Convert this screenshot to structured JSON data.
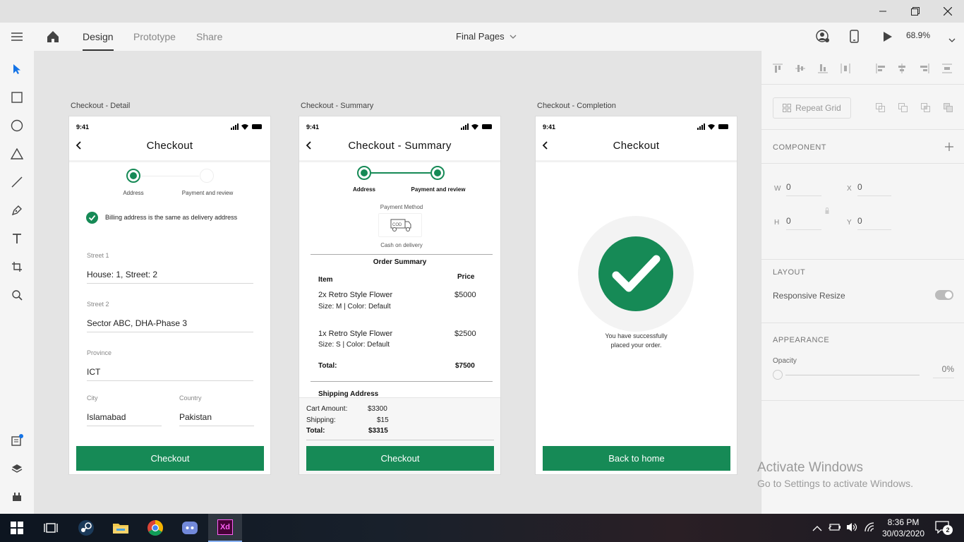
{
  "titlebar": {
    "minimize_icon": "minimize-icon",
    "maximize_icon": "restore-icon",
    "close_icon": "close-icon"
  },
  "menubar": {
    "tabs": [
      "Design",
      "Prototype",
      "Share"
    ],
    "document_title": "Final Pages",
    "zoom": "68.9%"
  },
  "artboards": {
    "detail": {
      "label": "Checkout - Detail",
      "time": "9:41",
      "title": "Checkout",
      "steps": [
        "Address",
        "Payment and review"
      ],
      "billing_same": "Billing address is the same as delivery address",
      "fields": {
        "street1_label": "Street 1",
        "street1_value": "House: 1, Street: 2",
        "street2_label": "Street 2",
        "street2_value": "Sector ABC, DHA-Phase 3",
        "province_label": "Province",
        "province_value": "ICT",
        "city_label": "City",
        "city_value": "Islamabad",
        "country_label": "Country",
        "country_value": "Pakistan"
      },
      "button": "Checkout"
    },
    "summary": {
      "label": "Checkout - Summary",
      "time": "9:41",
      "title": "Checkout - Summary",
      "steps": [
        "Address",
        "Payment and review"
      ],
      "payment_method_label": "Payment Method",
      "cod_text": "COD",
      "cash_on_delivery": "Cash on delivery",
      "order_summary": "Order Summary",
      "col_item": "Item",
      "col_price": "Price",
      "items": [
        {
          "name": "2x Retro Style Flower",
          "detail": "Size: M | Color: Default",
          "price": "$5000"
        },
        {
          "name": "1x Retro Style Flower",
          "detail": "Size: S | Color: Default",
          "price": "$2500"
        }
      ],
      "total_label": "Total:",
      "total_value": "$7500",
      "shipping_address": "Shipping Address",
      "cart_amount_label": "Cart Amount:",
      "cart_amount_value": "$3300",
      "shipping_label": "Shipping:",
      "shipping_value": "$15",
      "grand_total_label": "Total:",
      "grand_total_value": "$3315",
      "button": "Checkout"
    },
    "completion": {
      "label": "Checkout - Completion",
      "time": "9:41",
      "title": "Checkout",
      "message_line1": "You have successfully",
      "message_line2": "placed your order.",
      "button": "Back to home"
    }
  },
  "properties": {
    "repeat_grid": "Repeat Grid",
    "component": "COMPONENT",
    "w_label": "W",
    "w_value": "0",
    "x_label": "X",
    "x_value": "0",
    "h_label": "H",
    "h_value": "0",
    "y_label": "Y",
    "y_value": "0",
    "layout": "LAYOUT",
    "responsive_resize": "Responsive Resize",
    "appearance": "APPEARANCE",
    "opacity_label": "Opacity",
    "opacity_value": "0%"
  },
  "watermark": {
    "line1": "Activate Windows",
    "line2": "Go to Settings to activate Windows."
  },
  "taskbar": {
    "time": "8:36 PM",
    "date": "30/03/2020",
    "notification_count": "2",
    "app_xd": "Xd"
  },
  "colors": {
    "accent": "#168a56",
    "xd_brand": "#470137",
    "tool_active": "#1473e6"
  }
}
